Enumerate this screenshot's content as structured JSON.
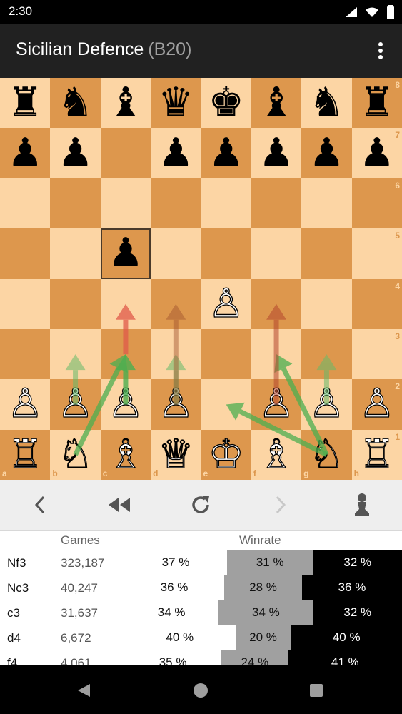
{
  "status": {
    "time": "2:30"
  },
  "header": {
    "title": "Sicilian Defence",
    "eco": "(B20)"
  },
  "board": {
    "ranks": [
      "8",
      "7",
      "6",
      "5",
      "4",
      "3",
      "2",
      "1"
    ],
    "files": [
      "a",
      "b",
      "c",
      "d",
      "e",
      "f",
      "g",
      "h"
    ],
    "highlight": "c5",
    "pieces": {
      "a8": "♜",
      "b8": "♞",
      "c8": "♝",
      "d8": "♛",
      "e8": "♚",
      "f8": "♝",
      "g8": "♞",
      "h8": "♜",
      "a7": "♟",
      "b7": "♟",
      "d7": "♟",
      "e7": "♟",
      "f7": "♟",
      "g7": "♟",
      "h7": "♟",
      "c5": "♟",
      "e4": "♙",
      "a2": "♙",
      "b2": "♙",
      "c2": "♙",
      "d2": "♙",
      "f2": "♙",
      "g2": "♙",
      "h2": "♙",
      "a1": "♖",
      "b1": "♘",
      "c1": "♗",
      "d1": "♕",
      "e1": "♔",
      "f1": "♗",
      "g1": "♘",
      "h1": "♖"
    },
    "arrows": [
      {
        "from": "b1",
        "to": "c3",
        "color": "#4caf50",
        "opacity": 0.75
      },
      {
        "from": "g1",
        "to": "f3",
        "color": "#4caf50",
        "opacity": 0.75
      },
      {
        "from": "g1",
        "to": "e2",
        "color": "#4caf50",
        "opacity": 0.75
      },
      {
        "from": "b2",
        "to": "b3",
        "color": "#66bb6a",
        "opacity": 0.55
      },
      {
        "from": "c2",
        "to": "c3",
        "color": "#4caf50",
        "opacity": 0.8
      },
      {
        "from": "d2",
        "to": "d3",
        "color": "#66bb6a",
        "opacity": 0.55
      },
      {
        "from": "g2",
        "to": "g3",
        "color": "#66bb6a",
        "opacity": 0.55
      },
      {
        "from": "c3",
        "to": "c4",
        "color": "#e05a4a",
        "opacity": 0.75
      },
      {
        "from": "d2",
        "to": "d4",
        "color": "#a0522d",
        "opacity": 0.45
      },
      {
        "from": "f2",
        "to": "f4",
        "color": "#b5462e",
        "opacity": 0.55
      }
    ]
  },
  "controls": {
    "prev_icon": "chevron-left-icon",
    "first_icon": "rewind-icon",
    "reset_icon": "refresh-icon",
    "next_icon": "chevron-right-icon",
    "side_icon": "pawn-icon"
  },
  "table": {
    "header_games": "Games",
    "header_winrate": "Winrate",
    "rows": [
      {
        "move": "Nf3",
        "games": "323,187",
        "white": 37,
        "draw": 31,
        "black": 32,
        "white_label": "37 %",
        "draw_label": "31 %",
        "black_label": "32 %"
      },
      {
        "move": "Nc3",
        "games": "40,247",
        "white": 36,
        "draw": 28,
        "black": 36,
        "white_label": "36 %",
        "draw_label": "28 %",
        "black_label": "36 %"
      },
      {
        "move": "c3",
        "games": "31,637",
        "white": 34,
        "draw": 34,
        "black": 32,
        "white_label": "34 %",
        "draw_label": "34 %",
        "black_label": "32 %"
      },
      {
        "move": "d4",
        "games": "6,672",
        "white": 40,
        "draw": 20,
        "black": 40,
        "white_label": "40 %",
        "draw_label": "20 %",
        "black_label": "40 %"
      },
      {
        "move": "f4",
        "games": "4,061",
        "white": 35,
        "draw": 24,
        "black": 41,
        "white_label": "35 %",
        "draw_label": "24 %",
        "black_label": "41 %"
      }
    ]
  },
  "colors": {
    "light_square": "#fcd5a4",
    "dark_square": "#dd974d",
    "appbar": "#212121"
  }
}
